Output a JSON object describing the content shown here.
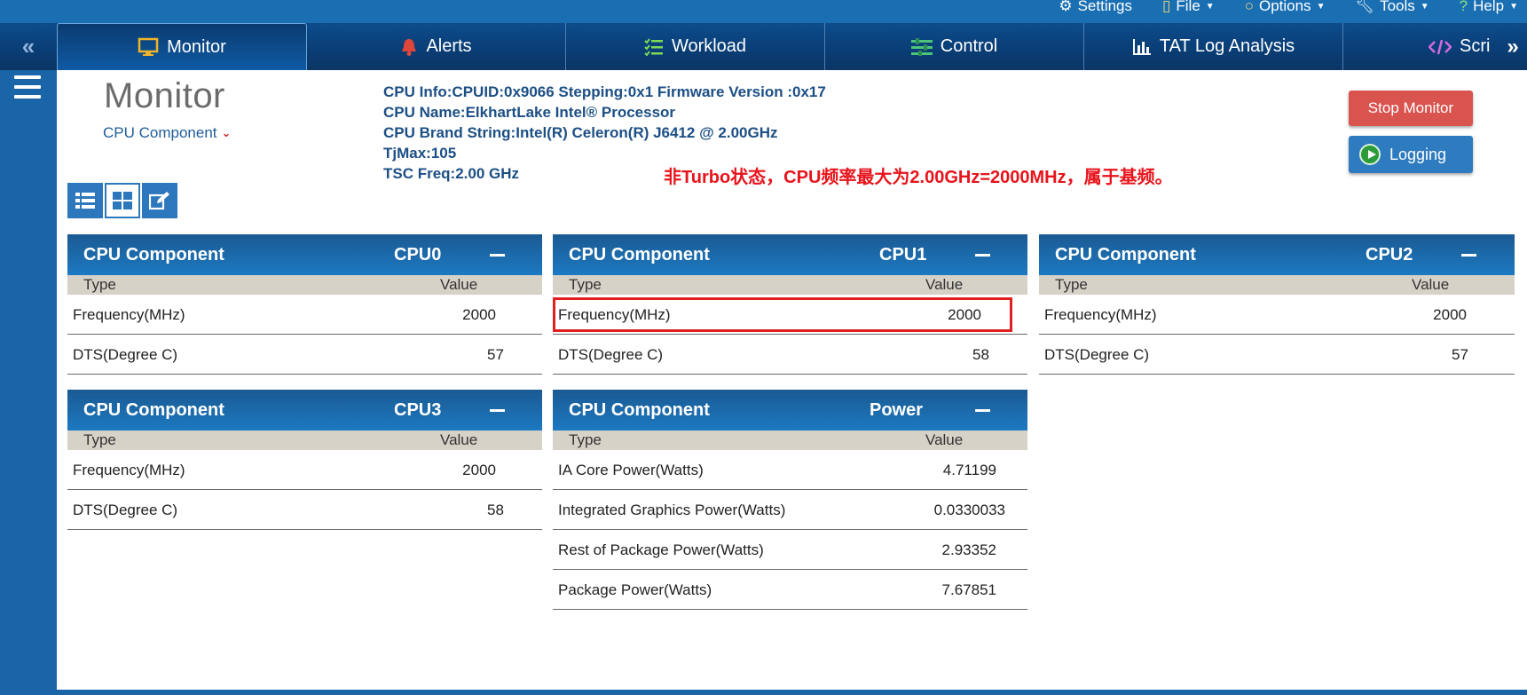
{
  "topmenu": {
    "items": [
      {
        "icon": "gear-icon",
        "label": "Settings"
      },
      {
        "icon": "file-icon",
        "label": "File"
      },
      {
        "icon": "circle-icon",
        "label": "Options"
      },
      {
        "icon": "wrench-icon",
        "label": "Tools"
      },
      {
        "icon": "question-icon",
        "label": "Help"
      }
    ]
  },
  "tabs": {
    "items": [
      {
        "icon": "monitor-icon",
        "label": "Monitor"
      },
      {
        "icon": "bell-icon",
        "label": "Alerts"
      },
      {
        "icon": "checklist-icon",
        "label": "Workload"
      },
      {
        "icon": "sliders-icon",
        "label": "Control"
      },
      {
        "icon": "bar-chart-icon",
        "label": "TAT Log Analysis"
      },
      {
        "icon": "code-icon",
        "label": "Scri"
      }
    ]
  },
  "header": {
    "title": "Monitor",
    "component_select": "CPU Component"
  },
  "cpu_info": {
    "line1": "CPU Info:CPUID:0x9066 Stepping:0x1 Firmware Version :0x17",
    "line2": "CPU Name:ElkhartLake Intel® Processor",
    "line3": "CPU Brand String:Intel(R) Celeron(R) J6412 @ 2.00GHz",
    "line4": "TjMax:105",
    "line5": "TSC Freq:2.00 GHz"
  },
  "annotation": "非Turbo状态，CPU频率最大为2.00GHz=2000MHz，属于基频。",
  "buttons": {
    "stop": "Stop Monitor",
    "logging": "Logging"
  },
  "columns": {
    "type": "Type",
    "value": "Value"
  },
  "panels": {
    "cpu0": {
      "title": "CPU Component",
      "name": "CPU0",
      "rows": [
        {
          "type": "Frequency(MHz)",
          "value": "2000"
        },
        {
          "type": "DTS(Degree C)",
          "value": "57"
        }
      ]
    },
    "cpu1": {
      "title": "CPU Component",
      "name": "CPU1",
      "rows": [
        {
          "type": "Frequency(MHz)",
          "value": "2000"
        },
        {
          "type": "DTS(Degree C)",
          "value": "58"
        }
      ]
    },
    "cpu2": {
      "title": "CPU Component",
      "name": "CPU2",
      "rows": [
        {
          "type": "Frequency(MHz)",
          "value": "2000"
        },
        {
          "type": "DTS(Degree C)",
          "value": "57"
        }
      ]
    },
    "cpu3": {
      "title": "CPU Component",
      "name": "CPU3",
      "rows": [
        {
          "type": "Frequency(MHz)",
          "value": "2000"
        },
        {
          "type": "DTS(Degree C)",
          "value": "58"
        }
      ]
    },
    "power": {
      "title": "CPU Component",
      "name": "Power",
      "rows": [
        {
          "type": "IA Core Power(Watts)",
          "value": "4.71199"
        },
        {
          "type": "Integrated Graphics Power(Watts)",
          "value": "0.0330033"
        },
        {
          "type": "Rest of Package Power(Watts)",
          "value": "2.93352"
        },
        {
          "type": "Package Power(Watts)",
          "value": "7.67851"
        }
      ]
    }
  },
  "colors": {
    "tabbar": "#0b3f78",
    "accent": "#1c79c2",
    "stop_button": "#d9534f",
    "annotation": "#e8141c",
    "highlight": "#e02020"
  }
}
